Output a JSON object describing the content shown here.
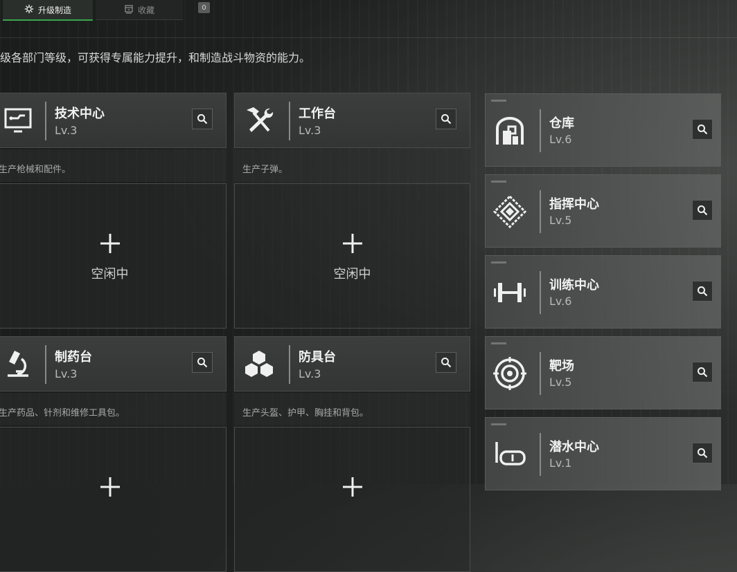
{
  "tabs": [
    {
      "label": "升级制造",
      "icon": "gear-icon",
      "active": true
    },
    {
      "label": "收藏",
      "icon": "archive-icon",
      "active": false
    }
  ],
  "tab_badge": "0",
  "subtitle": "升级各部门等级，可获得专属能力提升，和制造战斗物资的能力。",
  "stations": [
    {
      "name": "技术中心",
      "level": "Lv.3",
      "desc": "生产枪械和配件。",
      "slot_label": "空闲中",
      "icon": "computer-icon"
    },
    {
      "name": "工作台",
      "level": "Lv.3",
      "desc": "生产子弹。",
      "slot_label": "空闲中",
      "icon": "hammer-wrench-icon"
    },
    {
      "name": "制药台",
      "level": "Lv.3",
      "desc": "生产药品、针剂和维修工具包。",
      "slot_label": "",
      "icon": "microscope-icon"
    },
    {
      "name": "防具台",
      "level": "Lv.3",
      "desc": "生产头盔、护甲、胸挂和背包。",
      "slot_label": "",
      "icon": "cubes-icon"
    }
  ],
  "facilities": [
    {
      "name": "仓库",
      "level": "Lv.6",
      "icon": "warehouse-icon"
    },
    {
      "name": "指挥中心",
      "level": "Lv.5",
      "icon": "command-diamond-icon"
    },
    {
      "name": "训练中心",
      "level": "Lv.6",
      "icon": "dumbbell-icon"
    },
    {
      "name": "靶场",
      "level": "Lv.5",
      "icon": "target-icon"
    },
    {
      "name": "潜水中心",
      "level": "Lv.1",
      "icon": "diving-mask-icon"
    }
  ],
  "colors": {
    "accent": "#3aa64a",
    "panel": "#353737",
    "text": "#f2f2f2"
  }
}
